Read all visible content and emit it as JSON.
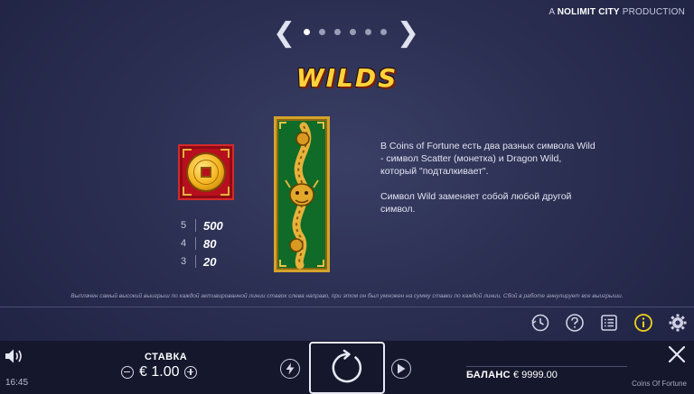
{
  "header": {
    "credit_prefix": "A",
    "credit_brand": "NOLIMIT CITY",
    "credit_suffix": "PRODUCTION"
  },
  "pager": {
    "prev_icon": "chevron-left-icon",
    "next_icon": "chevron-right-icon",
    "page_count": 6,
    "active_page": 1
  },
  "page": {
    "title": "WILDS",
    "description_1": "В Coins of Fortune есть два разных символа Wild - символ Scatter (монетка) и Dragon Wild, который \"подталкивает\".",
    "description_2": "Символ Wild заменяет собой любой другой символ.",
    "paytable": [
      {
        "count": "5",
        "value": "500"
      },
      {
        "count": "4",
        "value": "80"
      },
      {
        "count": "3",
        "value": "20"
      }
    ],
    "disclaimer": "Выплачен самый высокий выигрыш по каждой активированной линии ставок слева направо, при этом он был умножен на сумму ставки по каждой линии. Сбой в работе аннулирует все выигрыши."
  },
  "toolbar": {
    "icons": [
      "history-icon",
      "help-icon",
      "paytable-icon",
      "info-icon",
      "settings-icon"
    ],
    "accent": "#f2d21c"
  },
  "bottom": {
    "time": "16:45",
    "bet_label": "СТАВКА",
    "bet_value": "€ 1.00",
    "balance_label": "БАЛАНС",
    "balance_value": "€ 9999.00",
    "game_name": "Coins Of Fortune"
  }
}
